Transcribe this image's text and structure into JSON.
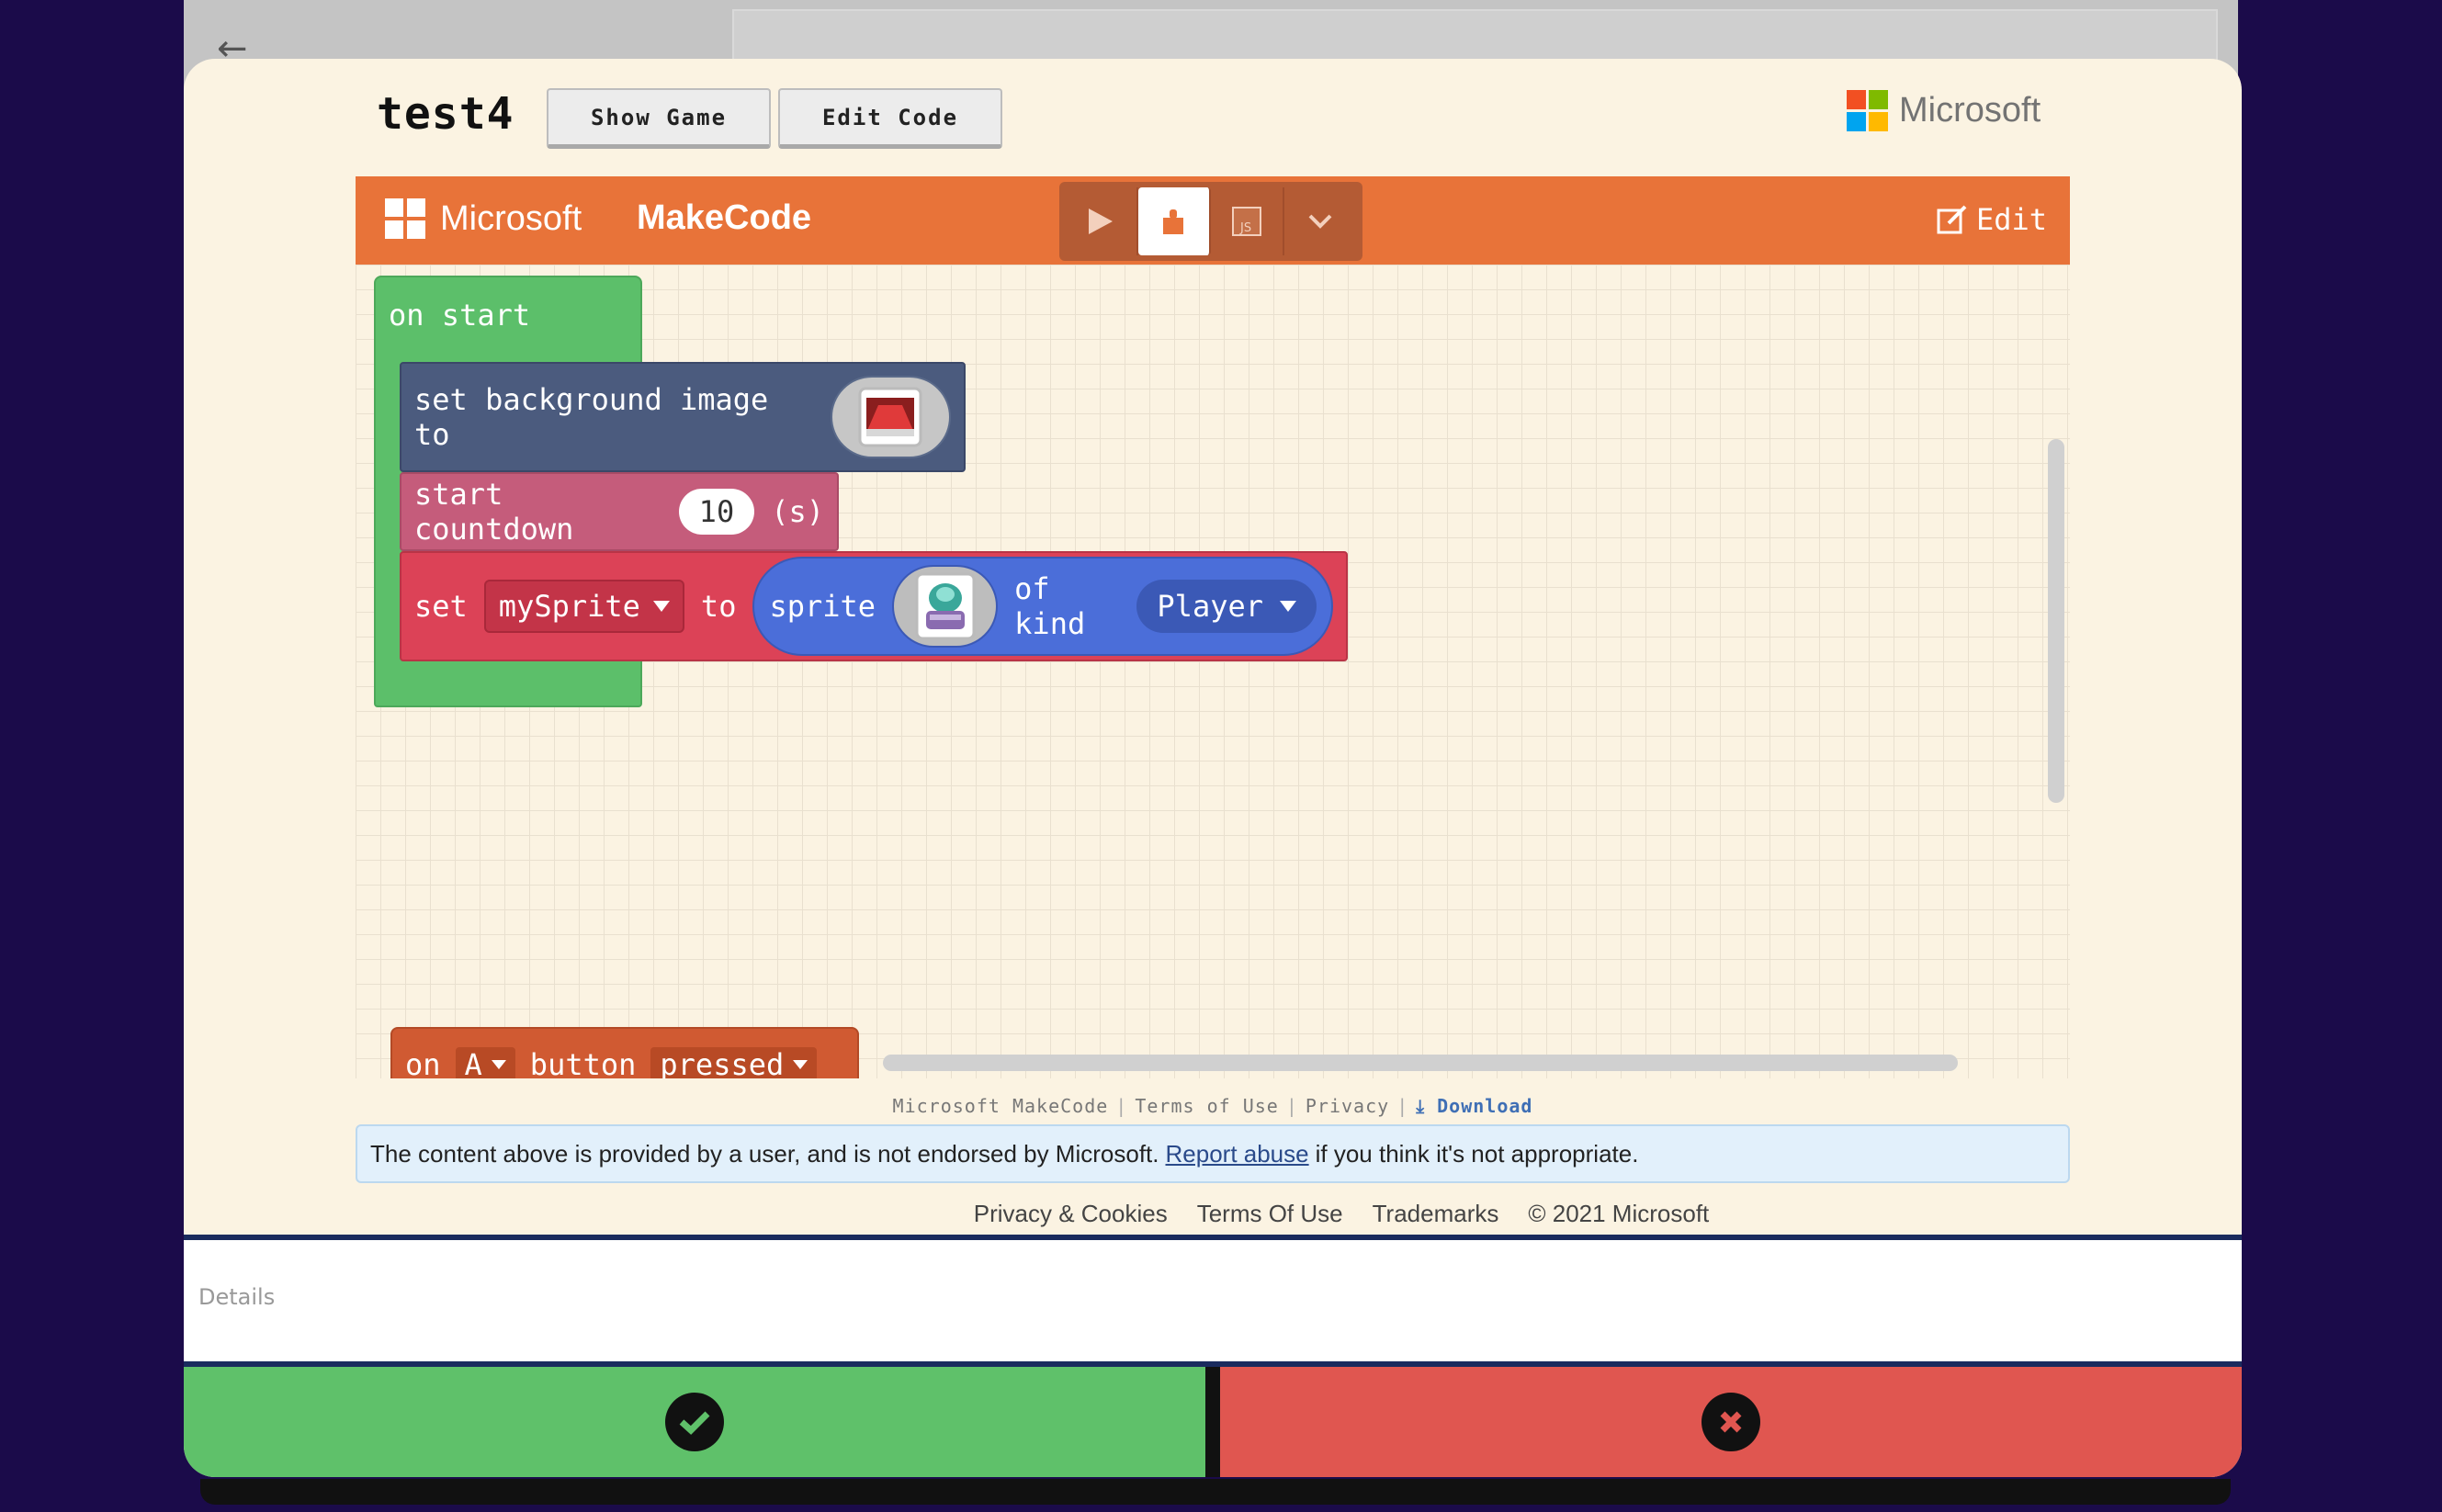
{
  "project": {
    "title": "test4"
  },
  "toolbar": {
    "show_game": "Show Game",
    "edit_code": "Edit Code"
  },
  "brand": {
    "microsoft": "Microsoft",
    "makecode": "MakeCode",
    "edit": "Edit"
  },
  "colors": {
    "ms_red": "#f25022",
    "ms_green": "#7fba00",
    "ms_blue": "#00a4ef",
    "ms_yellow": "#ffb900",
    "makecode_orange": "#e87339",
    "confirm": "#5fc16a",
    "reject": "#e05650"
  },
  "blocks": {
    "on_start": "on start",
    "set_bg": "set background image to",
    "countdown": {
      "label": "start countdown",
      "value": "10",
      "unit": "(s)"
    },
    "set_sprite": {
      "set": "set",
      "var": "mySprite",
      "to": "to",
      "sprite": "sprite",
      "of_kind": "of kind",
      "kind": "Player"
    },
    "on_button": {
      "on": "on",
      "button_name": "A",
      "button": "button",
      "event": "pressed"
    }
  },
  "frame_footer": {
    "makecode": "Microsoft MakeCode",
    "terms": "Terms of Use",
    "privacy": "Privacy",
    "download": "Download"
  },
  "notice": {
    "before": "The content above is provided by a user, and is not endorsed by Microsoft.",
    "link": "Report abuse",
    "after": "if you think it's not appropriate."
  },
  "site_footer": {
    "privacy": "Privacy & Cookies",
    "terms": "Terms Of Use",
    "trademarks": "Trademarks",
    "copyright": "© 2021 Microsoft"
  },
  "details": {
    "placeholder": "Details"
  }
}
